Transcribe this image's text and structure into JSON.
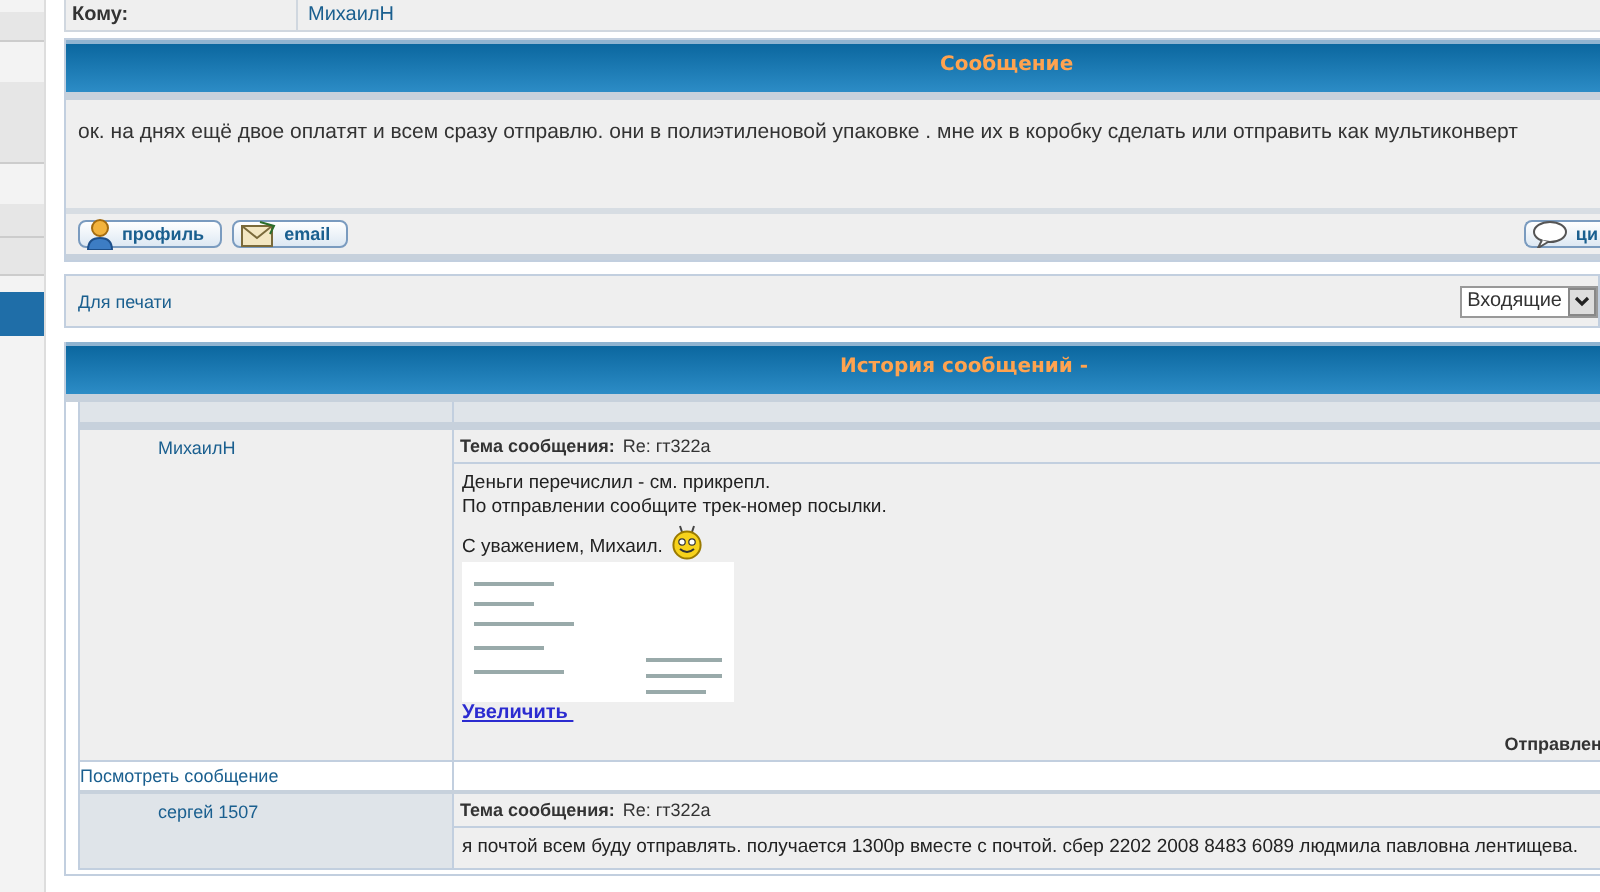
{
  "recipient": {
    "label": "Кому:",
    "name": "МихаилН"
  },
  "message": {
    "title": "Сообщение",
    "body": "ок. на днях ещё двое оплатят и всем сразу отправлю. они в полиэтиленовой упаковке . мне их в коробку сделать или отправить как мультиконверт",
    "buttons": [
      {
        "kind": "profile",
        "label": "профиль"
      },
      {
        "kind": "email",
        "label": "email"
      },
      {
        "kind": "quote",
        "label": "ци"
      }
    ]
  },
  "toolbar": {
    "print_link": "Для печати",
    "folder_select": {
      "value": "Входящие"
    }
  },
  "history": {
    "title": "История сообщений -",
    "posts": [
      {
        "author": "МихаилН",
        "subject_label": "Тема сообщения:",
        "subject": "Re: гт322а",
        "lines": [
          "Деньги перечислил - см. прикрепл.",
          "По отправлении сообщите трек-номер посылки."
        ],
        "signature": "С уважением, Михаил.",
        "attachment_link": "Увеличить",
        "sent_label": "Отправлен",
        "view_link": "Посмотреть сообщение"
      },
      {
        "author": "сергей 1507",
        "subject_label": "Тема сообщения:",
        "subject": "Re: гт322а",
        "lines": [
          "я почтой всем буду отправлять. получается 1300р вместе с почтой. сбер 2202 2008 8483 6089 людмила павловна лентищева."
        ]
      }
    ]
  }
}
